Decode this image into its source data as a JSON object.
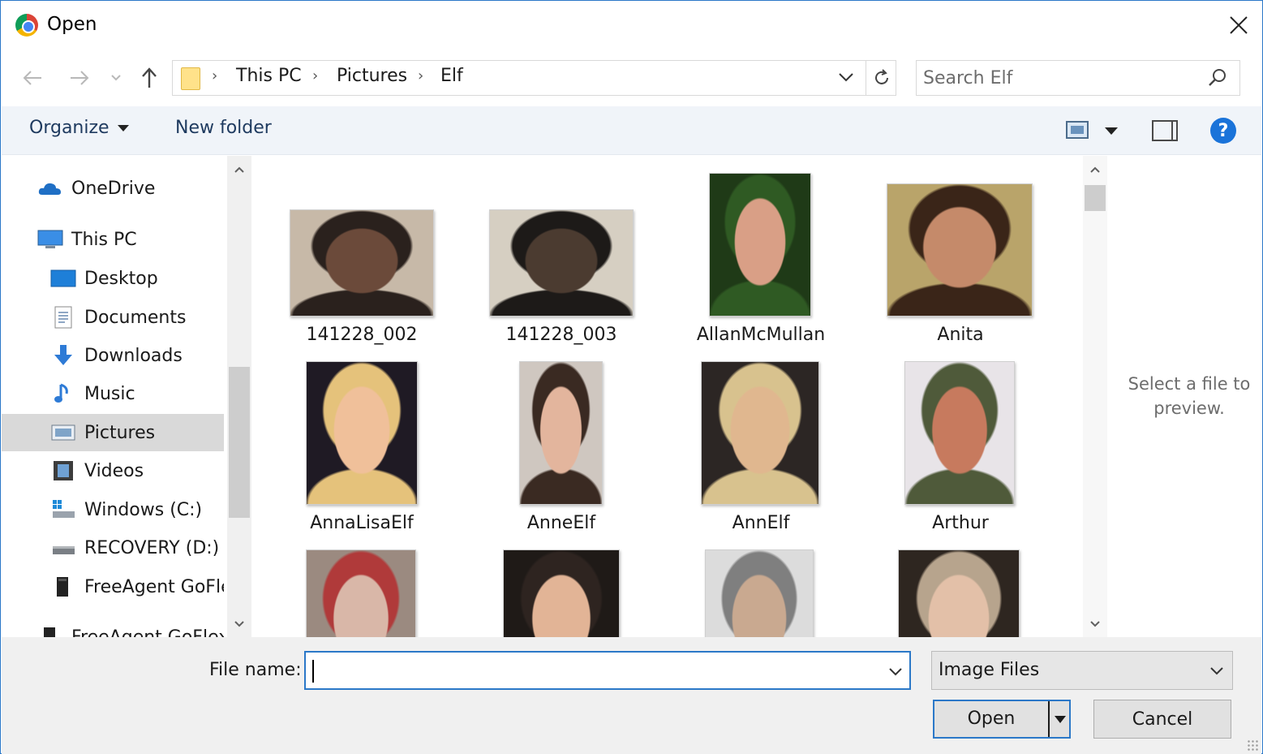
{
  "window": {
    "title": "Open",
    "app_icon": "chrome-icon",
    "close_icon": "close-icon"
  },
  "navigation": {
    "back_icon": "back-arrow-icon",
    "forward_icon": "forward-arrow-icon",
    "recent_icon": "chevron-down-icon",
    "up_icon": "up-arrow-icon"
  },
  "address_bar": {
    "folder_icon": "folder-icon",
    "breadcrumbs": [
      "This PC",
      "Pictures",
      "Elf"
    ],
    "separator": "›",
    "dropdown_icon": "chevron-down-icon",
    "refresh_icon": "refresh-icon"
  },
  "search": {
    "placeholder": "Search Elf",
    "value": "",
    "icon": "search-icon"
  },
  "toolbar": {
    "organize_label": "Organize",
    "new_folder_label": "New folder",
    "view_icon": "view-options-icon",
    "preview_pane_icon": "preview-pane-icon",
    "help_icon": "help-icon",
    "help_text": "?"
  },
  "nav_pane": {
    "items": [
      {
        "label": "OneDrive",
        "icon": "onedrive-icon"
      },
      {
        "label": "This PC",
        "icon": "computer-icon"
      },
      {
        "label": "Desktop",
        "icon": "desktop-icon"
      },
      {
        "label": "Documents",
        "icon": "documents-icon"
      },
      {
        "label": "Downloads",
        "icon": "downloads-icon"
      },
      {
        "label": "Music",
        "icon": "music-icon"
      },
      {
        "label": "Pictures",
        "icon": "pictures-icon",
        "selected": true
      },
      {
        "label": "Videos",
        "icon": "videos-icon"
      },
      {
        "label": "Windows (C:)",
        "icon": "drive-c-icon"
      },
      {
        "label": "RECOVERY (D:)",
        "icon": "drive-d-icon"
      },
      {
        "label": "FreeAgent GoFle",
        "icon": "usb-drive-icon"
      },
      {
        "label": "FreeAgent GoFlex",
        "icon": "usb-drive-icon"
      }
    ]
  },
  "files": [
    {
      "name": "141228_002",
      "colors": [
        "#6b4a3a",
        "#2a211d",
        "#c7b9a8"
      ]
    },
    {
      "name": "141228_003",
      "colors": [
        "#4b3b30",
        "#1d1a18",
        "#d6cfc2"
      ]
    },
    {
      "name": "AllanMcMullan",
      "colors": [
        "#d99f86",
        "#2f5a23",
        "#1f3a17"
      ]
    },
    {
      "name": "Anita",
      "colors": [
        "#c58a6a",
        "#3a2518",
        "#b9a46a"
      ]
    },
    {
      "name": "AnnaLisaElf",
      "colors": [
        "#f0c09a",
        "#e5c27b",
        "#1f1a24"
      ]
    },
    {
      "name": "AnneElf",
      "colors": [
        "#e3b59d",
        "#3a2a22",
        "#cfc7c0"
      ]
    },
    {
      "name": "AnnElf",
      "colors": [
        "#e0b78f",
        "#d8c28e",
        "#2c2624"
      ]
    },
    {
      "name": "Arthur",
      "colors": [
        "#c77a5e",
        "#4f5a3a",
        "#e8e4e8"
      ]
    },
    {
      "name": "",
      "colors": [
        "#d9b7a8",
        "#b03a3a",
        "#9b8a80"
      ]
    },
    {
      "name": "",
      "colors": [
        "#e2b496",
        "#2e2420",
        "#1f1a17"
      ]
    },
    {
      "name": "",
      "colors": [
        "#c9a990",
        "#7f7f7f",
        "#dcdcdc"
      ]
    },
    {
      "name": "",
      "colors": [
        "#e3c0a8",
        "#b7a48d",
        "#2e2620"
      ]
    }
  ],
  "preview_pane": {
    "message": "Select a file to preview."
  },
  "footer": {
    "file_name_label": "File name:",
    "file_name_value": "",
    "file_type_value": "Image Files",
    "open_label": "Open",
    "cancel_label": "Cancel"
  },
  "colors": {
    "accent": "#2b78c8",
    "selection": "#d9d9d9",
    "toolbar_bg": "#f0f4f9",
    "footer_bg": "#f0f0f0"
  }
}
